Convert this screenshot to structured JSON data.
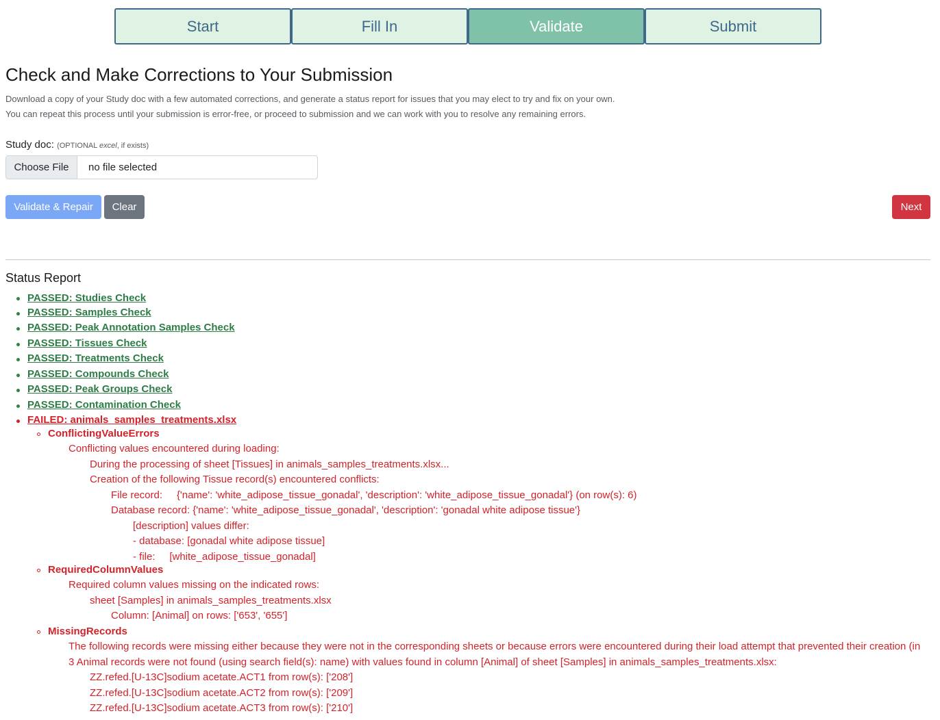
{
  "steps": [
    {
      "label": "Start",
      "active": false
    },
    {
      "label": "Fill In",
      "active": false
    },
    {
      "label": "Validate",
      "active": true
    },
    {
      "label": "Submit",
      "active": false
    }
  ],
  "page_title": "Check and Make Corrections to Your Submission",
  "intro": {
    "line1": "Download a copy of your Study doc with a few automated corrections, and generate a status report for issues that you may elect to try and fix on your own.",
    "line2": "You can repeat this process until your submission is error-free, or proceed to submission and we can work with you to resolve any remaining errors."
  },
  "study_doc": {
    "label": "Study doc:",
    "hint_prefix": "(OPTIONAL ",
    "hint_em": "excel",
    "hint_suffix": ", if exists)",
    "choose_label": "Choose File",
    "file_status": "no file selected"
  },
  "buttons": {
    "validate": "Validate & Repair",
    "clear": "Clear",
    "next": "Next"
  },
  "colors": {
    "step_active": "#80c1a9",
    "step_inactive": "#dff2e3",
    "step_border": "#3d6a8a",
    "passed": "#2e7d46",
    "failed": "#d1232a",
    "validate_button": "#7ba7f7",
    "clear_button": "#6c757d",
    "next_button": "#d1353f"
  },
  "report": {
    "title": "Status Report",
    "passed": [
      "PASSED: Studies Check",
      "PASSED: Samples Check",
      "PASSED: Peak Annotation Samples Check",
      "PASSED: Tissues Check",
      "PASSED: Treatments Check",
      "PASSED: Compounds Check",
      "PASSED: Peak Groups Check",
      "PASSED: Contamination Check"
    ],
    "failed": "FAILED: animals_samples_treatments.xlsx",
    "errors": {
      "conflicting": {
        "name": "ConflictingValueErrors",
        "lines": [
          "Conflicting values encountered during loading:",
          "During the processing of sheet [Tissues] in animals_samples_treatments.xlsx...",
          "Creation of the following Tissue record(s) encountered conflicts:",
          "File record:     {'name': 'white_adipose_tissue_gonadal', 'description': 'white_adipose_tissue_gonadal'} (on row(s): 6)",
          "Database record: {'name': 'white_adipose_tissue_gonadal', 'description': 'gonadal white adipose tissue'}",
          "[description] values differ:",
          "- database: [gonadal white adipose tissue]",
          "- file:     [white_adipose_tissue_gonadal]"
        ]
      },
      "required": {
        "name": "RequiredColumnValues",
        "lines": [
          "Required column values missing on the indicated rows:",
          "sheet [Samples] in animals_samples_treatments.xlsx",
          "Column: [Animal] on rows: ['653', '655']"
        ]
      },
      "missing": {
        "name": "MissingRecords",
        "lines": [
          "The following records were missing either because they were not in the corresponding sheets or because errors were encountered during their load attempt that prevented their creation (in",
          "3 Animal records were not found (using search field(s): name) with values found in column [Animal] of sheet [Samples] in animals_samples_treatments.xlsx:",
          "ZZ.refed.[U-13C]sodium acetate.ACT1 from row(s): ['208']",
          "ZZ.refed.[U-13C]sodium acetate.ACT2 from row(s): ['209']",
          "ZZ.refed.[U-13C]sodium acetate.ACT3 from row(s): ['210']"
        ]
      }
    }
  }
}
